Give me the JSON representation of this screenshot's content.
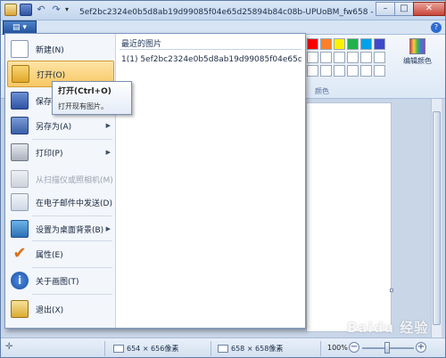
{
  "window": {
    "title": "5ef2bc2324e0b5d8ab19d99085f04e65d25894b84c08b-UPUoBM_fw658 - 副本.jpg - 画图"
  },
  "titlebar": {
    "minimize": "–",
    "maximize": "□",
    "close": "✕"
  },
  "appmenu": {
    "items": [
      {
        "label": "新建(N)",
        "icon": "new-icon"
      },
      {
        "label": "打开(O)",
        "icon": "open-icon"
      },
      {
        "label": "保存(S)",
        "icon": "save-icon"
      },
      {
        "label": "另存为(A)",
        "icon": "save-as-icon",
        "has_submenu": true
      },
      {
        "label": "打印(P)",
        "icon": "print-icon",
        "has_submenu": true
      },
      {
        "label": "从扫描仪或照相机(M)",
        "icon": "scanner-icon",
        "disabled": true
      },
      {
        "label": "在电子邮件中发送(D)",
        "icon": "email-icon"
      },
      {
        "label": "设置为桌面背景(B)",
        "icon": "desktop-background-icon",
        "has_submenu": true
      },
      {
        "label": "属性(E)",
        "icon": "properties-icon"
      },
      {
        "label": "关于画图(T)",
        "icon": "about-icon"
      },
      {
        "label": "退出(X)",
        "icon": "exit-icon"
      }
    ],
    "recent_header": "最近的图片",
    "recent_items": [
      "1(1)  5ef2bc2324e0b5d8ab19d99085f04e65d25894b..."
    ]
  },
  "tooltip": {
    "title": "打开(Ctrl+O)",
    "description": "打开现有图片。"
  },
  "ribbon": {
    "colors_group_label": "颜色",
    "edit_colors_label": "编辑颜色",
    "palette_row1": [
      "#ff0000",
      "#ff7f27",
      "#fff200",
      "#22b14c",
      "#00a2e8",
      "#3f48cc"
    ],
    "palette_row2": [
      "#ffffff",
      "#ffffff",
      "#ffffff",
      "#ffffff",
      "#ffffff",
      "#ffffff"
    ],
    "palette_row3": [
      "#ffffff",
      "#ffffff",
      "#ffffff",
      "#ffffff",
      "#ffffff",
      "#ffffff"
    ]
  },
  "statusbar": {
    "selection_size": "654 × 656像素",
    "image_size": "658 × 658像素",
    "zoom": "100%",
    "zoom_level": 100
  },
  "watermark": "Baidu 经验"
}
